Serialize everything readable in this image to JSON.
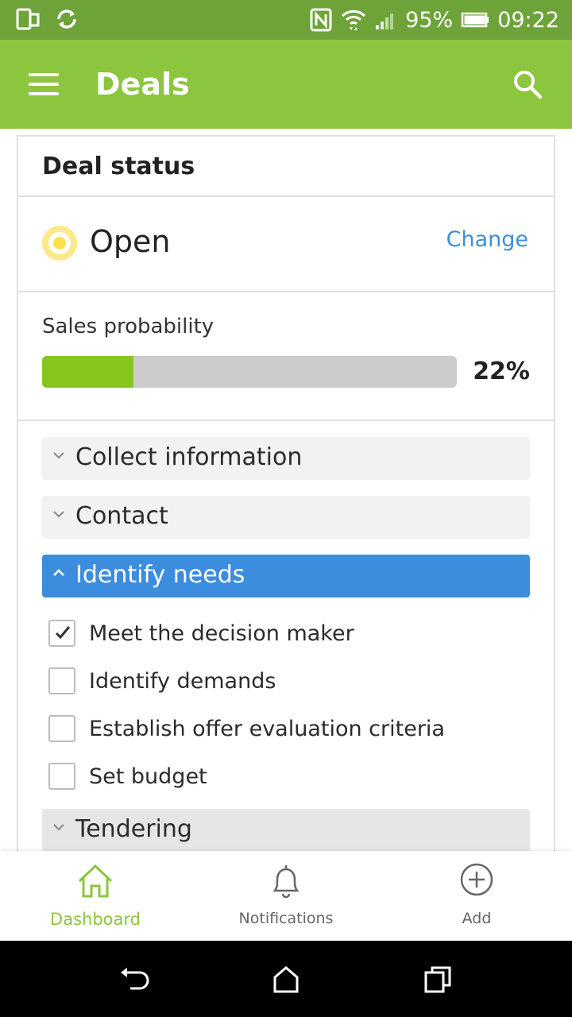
{
  "status_bar": {
    "battery": "95%",
    "time": "09:22"
  },
  "app_bar": {
    "title": "Deals",
    "menu_icon": "hamburger-menu-icon",
    "search_icon": "search-icon"
  },
  "card": {
    "header": "Deal status",
    "status": {
      "value": "Open",
      "change_label": "Change",
      "dot_color": "#fde060"
    },
    "probability": {
      "label": "Sales probability",
      "value_text": "22%",
      "fraction": 0.22,
      "fill_color": "#86c51c"
    },
    "stages": [
      {
        "label": "Collect information",
        "expanded": false
      },
      {
        "label": "Contact",
        "expanded": false
      },
      {
        "label": "Identify needs",
        "expanded": true
      },
      {
        "label": "Tendering",
        "expanded": false
      }
    ],
    "tasks": [
      {
        "label": "Meet the decision maker",
        "checked": true
      },
      {
        "label": "Identify demands",
        "checked": false
      },
      {
        "label": "Establish offer evaluation criteria",
        "checked": false
      },
      {
        "label": "Set budget",
        "checked": false
      }
    ]
  },
  "bottom_nav": [
    {
      "label": "Dashboard",
      "icon": "home-icon",
      "active": true
    },
    {
      "label": "Notifications",
      "icon": "bell-icon",
      "active": false
    },
    {
      "label": "Add",
      "icon": "plus-circle-icon",
      "active": false
    }
  ],
  "colors": {
    "app_bar": "#8cc63e",
    "status_bar": "#6ea33a",
    "active_stage": "#3d8ddf",
    "link": "#3f8fd6"
  }
}
